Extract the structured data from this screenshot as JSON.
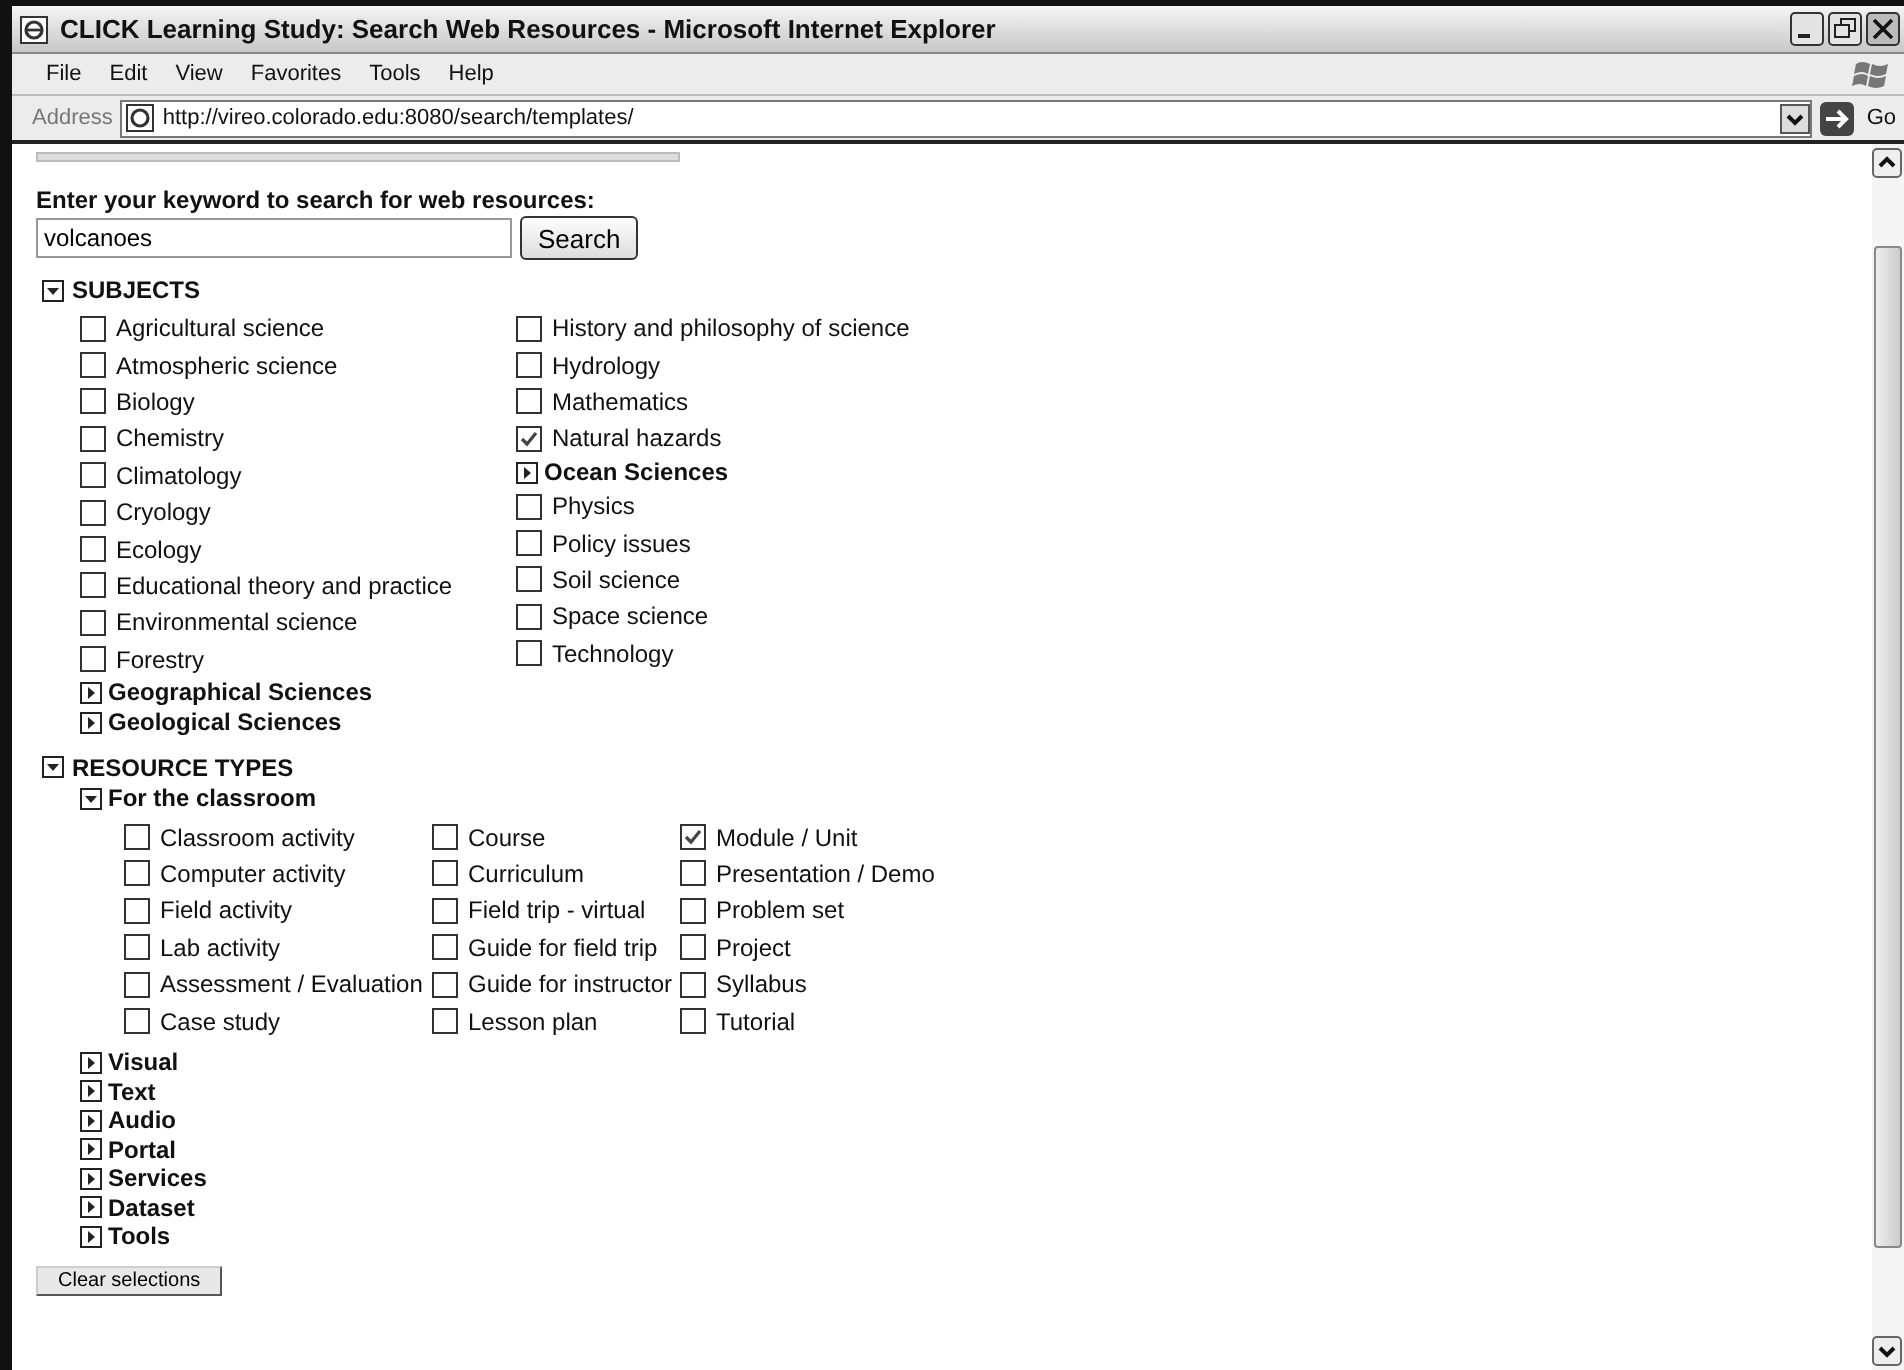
{
  "window": {
    "title": "CLICK Learning Study: Search Web Resources - Microsoft Internet Explorer"
  },
  "menu": [
    "File",
    "Edit",
    "View",
    "Favorites",
    "Tools",
    "Help"
  ],
  "address": {
    "label": "Address",
    "url": "http://vireo.colorado.edu:8080/search/templates/",
    "go": "Go"
  },
  "prompt": "Enter your keyword to search for web resources:",
  "search": {
    "value": "volcanoes",
    "button": "Search"
  },
  "subjects": {
    "label": "SUBJECTS",
    "expanded": true,
    "columns": [
      [
        {
          "kind": "checkbox",
          "label": "Agricultural science",
          "checked": false
        },
        {
          "kind": "checkbox",
          "label": "Atmospheric science",
          "checked": false
        },
        {
          "kind": "checkbox",
          "label": "Biology",
          "checked": false
        },
        {
          "kind": "checkbox",
          "label": "Chemistry",
          "checked": false
        },
        {
          "kind": "checkbox",
          "label": "Climatology",
          "checked": false
        },
        {
          "kind": "checkbox",
          "label": "Cryology",
          "checked": false
        },
        {
          "kind": "checkbox",
          "label": "Ecology",
          "checked": false
        },
        {
          "kind": "checkbox",
          "label": "Educational theory and practice",
          "checked": false
        },
        {
          "kind": "checkbox",
          "label": "Environmental science",
          "checked": false
        },
        {
          "kind": "checkbox",
          "label": "Forestry",
          "checked": false
        },
        {
          "kind": "group",
          "label": "Geographical Sciences",
          "expanded": false
        },
        {
          "kind": "group",
          "label": "Geological Sciences",
          "expanded": false
        }
      ],
      [
        {
          "kind": "checkbox",
          "label": "History and philosophy of science",
          "checked": false
        },
        {
          "kind": "checkbox",
          "label": "Hydrology",
          "checked": false
        },
        {
          "kind": "checkbox",
          "label": "Mathematics",
          "checked": false
        },
        {
          "kind": "checkbox",
          "label": "Natural hazards",
          "checked": true
        },
        {
          "kind": "group",
          "label": "Ocean Sciences",
          "expanded": false
        },
        {
          "kind": "checkbox",
          "label": "Physics",
          "checked": false
        },
        {
          "kind": "checkbox",
          "label": "Policy issues",
          "checked": false
        },
        {
          "kind": "checkbox",
          "label": "Soil science",
          "checked": false
        },
        {
          "kind": "checkbox",
          "label": "Space science",
          "checked": false
        },
        {
          "kind": "checkbox",
          "label": "Technology",
          "checked": false
        }
      ]
    ]
  },
  "resource_types": {
    "label": "RESOURCE TYPES",
    "expanded": true,
    "children": [
      {
        "label": "For the classroom",
        "expanded": true,
        "columns": [
          [
            {
              "label": "Classroom activity",
              "checked": false
            },
            {
              "label": "Computer activity",
              "checked": false
            },
            {
              "label": "Field activity",
              "checked": false
            },
            {
              "label": "Lab activity",
              "checked": false
            },
            {
              "label": "Assessment / Evaluation",
              "checked": false
            },
            {
              "label": "Case study",
              "checked": false
            }
          ],
          [
            {
              "label": "Course",
              "checked": false
            },
            {
              "label": "Curriculum",
              "checked": false
            },
            {
              "label": "Field trip - virtual",
              "checked": false
            },
            {
              "label": "Guide for field trip",
              "checked": false
            },
            {
              "label": "Guide for instructor",
              "checked": false
            },
            {
              "label": "Lesson plan",
              "checked": false
            }
          ],
          [
            {
              "label": "Module / Unit",
              "checked": true
            },
            {
              "label": "Presentation / Demo",
              "checked": false
            },
            {
              "label": "Problem set",
              "checked": false
            },
            {
              "label": "Project",
              "checked": false
            },
            {
              "label": "Syllabus",
              "checked": false
            },
            {
              "label": "Tutorial",
              "checked": false
            }
          ]
        ]
      },
      {
        "label": "Visual",
        "expanded": false
      },
      {
        "label": "Text",
        "expanded": false
      },
      {
        "label": "Audio",
        "expanded": false
      },
      {
        "label": "Portal",
        "expanded": false
      },
      {
        "label": "Services",
        "expanded": false
      },
      {
        "label": "Dataset",
        "expanded": false
      },
      {
        "label": "Tools",
        "expanded": false
      }
    ]
  },
  "clear_button": "Clear selections"
}
